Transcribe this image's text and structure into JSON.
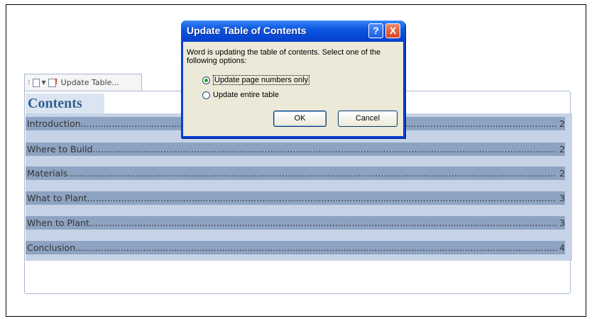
{
  "toc_control": {
    "tab_label": "Update Table...",
    "heading": "Contents"
  },
  "toc_entries": [
    {
      "title": "Introduction",
      "page": "2"
    },
    {
      "title": "Where to Build",
      "page": "2"
    },
    {
      "title": "Materials",
      "page": "2"
    },
    {
      "title": "What to Plant",
      "page": "3"
    },
    {
      "title": "When to Plant",
      "page": "3"
    },
    {
      "title": "Conclusion",
      "page": "4"
    }
  ],
  "dialog": {
    "title": "Update Table of Contents",
    "help_label": "?",
    "close_label": "X",
    "message": "Word is updating the table of contents.  Select one of the following options:",
    "options": [
      {
        "label": "Update page numbers only",
        "selected": true
      },
      {
        "label": "Update entire table",
        "selected": false
      }
    ],
    "ok_label": "OK",
    "cancel_label": "Cancel"
  },
  "colors": {
    "heading_text": "#365f91",
    "entry_highlight": "#8ea3c2",
    "dialog_titlebar": "#0d57e0"
  }
}
